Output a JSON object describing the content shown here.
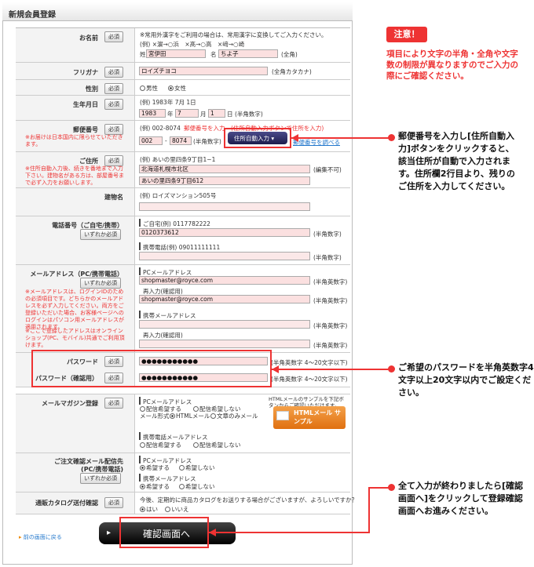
{
  "header": {
    "title": "新規会員登録"
  },
  "req": "必須",
  "req_either": "いずれか必須",
  "name": {
    "label": "お名前",
    "hint": "※常用外漢字をご利用の場合は、常用漢字に変換してご入力ください。",
    "example": "(例) ×濵→○浜　×髙→○高　×﨑→○崎",
    "sei_label": "姓",
    "sei": "宮伊田",
    "mei_label": "名",
    "mei": "ちよ子",
    "note": "(全角)"
  },
  "kana": {
    "label": "フリガナ",
    "value": "ロイズチヨコ",
    "note": "(全角カタカナ)"
  },
  "gender": {
    "label": "性別",
    "male": "男性",
    "female": "女性"
  },
  "birth": {
    "label": "生年月日",
    "example": "(例) 1983年 7月 1日",
    "year": "1983",
    "ym": "年",
    "month": "7",
    "mm": "月",
    "day": "1",
    "dm": "日",
    "note": "(半角数字)"
  },
  "zip": {
    "label": "郵便番号",
    "note": "※お届けは日本国内に限らせていただきます。",
    "example": "(例) 002-8074",
    "red_hint": "郵便番号を入力　(住所自動入力ボタンで住所を入力)",
    "a": "002",
    "b": "8074",
    "digits": "(半角数字)",
    "button": "住所自動入力 ▾",
    "link": "郵便番号を調べる"
  },
  "addr": {
    "label": "ご住所",
    "note": "※住所自動入力後、続きを番地まで入力下さい。建物名がある方は、部屋番号まで必ず入力をお願いします。",
    "example": "(例) あいの里四条9丁目1−1",
    "line1": "北海道札幌市北区",
    "line1_note": "(編集不可)",
    "line2": "あいの里四条9丁目612"
  },
  "bldg": {
    "label": "建物名",
    "example": "(例) ロイズマンション505号"
  },
  "phone": {
    "label": "電話番号（ご自宅/携帯）",
    "home_label": "ご自宅(例) 0117782222",
    "home": "0120373612",
    "mobile_label": "携帯電話(例) 09011111111",
    "note": "(半角数字)"
  },
  "email": {
    "label": "メールアドレス（PC/携帯電話）",
    "note1": "※メールアドレスは、ログインIDのための必須項目です。どちらかのメールアドレスを必ず入力してください。両方をご登録いただいた場合、お客様ページへのログインはパソコン用メールアドレスが適用されます。",
    "note2": "※ここで登録したアドレスはオンラインショップ(PC、モバイル)共通でご利用頂けます。",
    "pc_label": "PCメールアドレス",
    "pc": "shopmaster@royce.com",
    "pc_confirm_label": "再入力(確認用)",
    "pc_confirm": "shopmaster@royce.com",
    "note": "(半角英数字)",
    "mobile_label": "携帯メールアドレス",
    "mobile_confirm_label": "再入力(確認用)"
  },
  "password": {
    "label": "パスワード",
    "label2": "パスワード（確認用）",
    "value": "●●●●●●●●●●●",
    "note": "(半角英数字 4〜20文字以下)"
  },
  "magazine": {
    "label": "メールマガジン登録",
    "pc_label": "PCメールアドレス",
    "want": "配信希望する",
    "nowant": "配信希望しない",
    "format_label": "メール形式：",
    "html": "HTMLメール",
    "text": "文章のみメール",
    "sample_text": "HTMLメールのサンプルを下記ボタンからご確認いただけます。",
    "sample_btn": "HTMLメール サンプル",
    "mobile_label": "携帯電話メールアドレス"
  },
  "order_mail": {
    "label": "ご注文確認メール配信先",
    "label2": "(PC/携帯電話)",
    "pc_label": "PCメールアドレス",
    "yes": "希望する",
    "no": "希望しない",
    "mobile_label": "携帯メールアドレス"
  },
  "catalog": {
    "label": "通販カタログ送付確認",
    "question": "今後、定期的に商品カタログをお送りする場合がございますが、よろしいですか？",
    "yes": "はい",
    "no": "いいえ"
  },
  "back_link": "前の画面に戻る",
  "confirm_button": "確認画面へ",
  "side": {
    "caution": "注意！",
    "caution_text": "項目により文字の半角・全角や文字数の制限が異なりますのでご入力の際にご確認ください。",
    "zip_text": "郵便番号を入力し[住所自動入力]ボタンをクリックすると、該当住所が自動で入力されます。住所欄2行目より、残りのご住所を入力してください。",
    "pw_text": "ご希望のパスワードを半角英数字4文字以上20文字以内でご設定ください。",
    "done_text": "全て入力が終わりましたら[確認画面へ]をクリックして登録確認画面へお進みください。"
  },
  "colors": {
    "accent": "#e33333",
    "input_bg": "#fbe0e0"
  }
}
